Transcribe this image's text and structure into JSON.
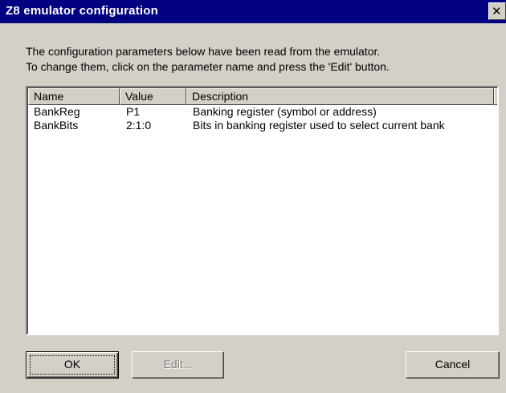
{
  "window": {
    "title": "Z8 emulator configuration",
    "close_glyph": "✕"
  },
  "description": {
    "line1": "The configuration parameters below have been read from the emulator.",
    "line2": "To change them, click on the parameter name and press the 'Edit' button."
  },
  "table": {
    "columns": [
      "Name",
      "Value",
      "Description"
    ],
    "rows": [
      {
        "name": "BankReg",
        "value": "P1",
        "description": "Banking register (symbol or address)"
      },
      {
        "name": "BankBits",
        "value": "2:1:0",
        "description": "Bits in banking register used to select current bank"
      }
    ]
  },
  "buttons": {
    "ok": "OK",
    "edit": "Edit...",
    "cancel": "Cancel"
  },
  "colors": {
    "titlebar": "#000080",
    "face": "#d4d0c8",
    "disabled_text": "#808080"
  },
  "icons": {
    "close": "close-icon"
  }
}
